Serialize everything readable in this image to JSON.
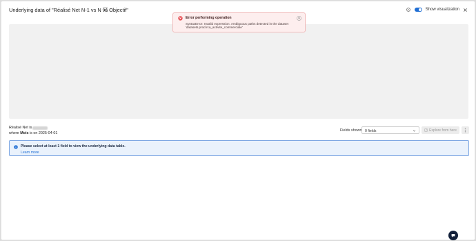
{
  "header": {
    "title": "Underlying data of \"Réalisé Net N-1 vs N vs Objectif\"",
    "toggle_label": "Show visualization",
    "toggle_on": true
  },
  "toast": {
    "title": "Error performing operation",
    "message": "SyntaxError: Invalid expression. Ambiguous paths detected in the dataset 'datasets.prod.rca_activite_commerciale'"
  },
  "meta": {
    "line1_prefix": "Réalisé Net is",
    "where_word": "where",
    "field": "Mois",
    "condition": "is on 2025-04-01"
  },
  "fields": {
    "label": "Fields shown",
    "value": "0 fields"
  },
  "explore": {
    "label": "Explore from here"
  },
  "info": {
    "text": "Please select at least 1 field to view the underlying data table.",
    "link": "Learn more"
  },
  "colors": {
    "accent": "#1f6ed4",
    "error": "#e5484d",
    "chat": "#13213b"
  }
}
